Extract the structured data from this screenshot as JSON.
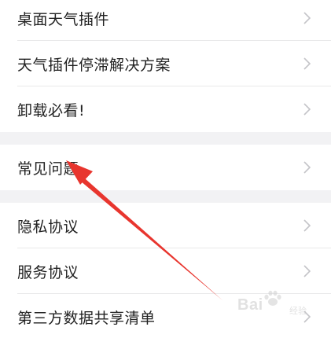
{
  "menu": {
    "group1": [
      {
        "label": "桌面天气插件"
      },
      {
        "label": "天气插件停滞解决方案"
      },
      {
        "label": "卸载必看!"
      }
    ],
    "group2": [
      {
        "label": "常见问题"
      }
    ],
    "group3": [
      {
        "label": "隐私协议"
      },
      {
        "label": "服务协议"
      },
      {
        "label": "第三方数据共享清单"
      }
    ]
  },
  "annotation": {
    "arrow_color": "#e8352e"
  },
  "watermark": {
    "text": "Bai",
    "sub": "经验",
    "icon": "paw-icon"
  },
  "icons": {
    "chevron": "chevron-right-icon"
  }
}
